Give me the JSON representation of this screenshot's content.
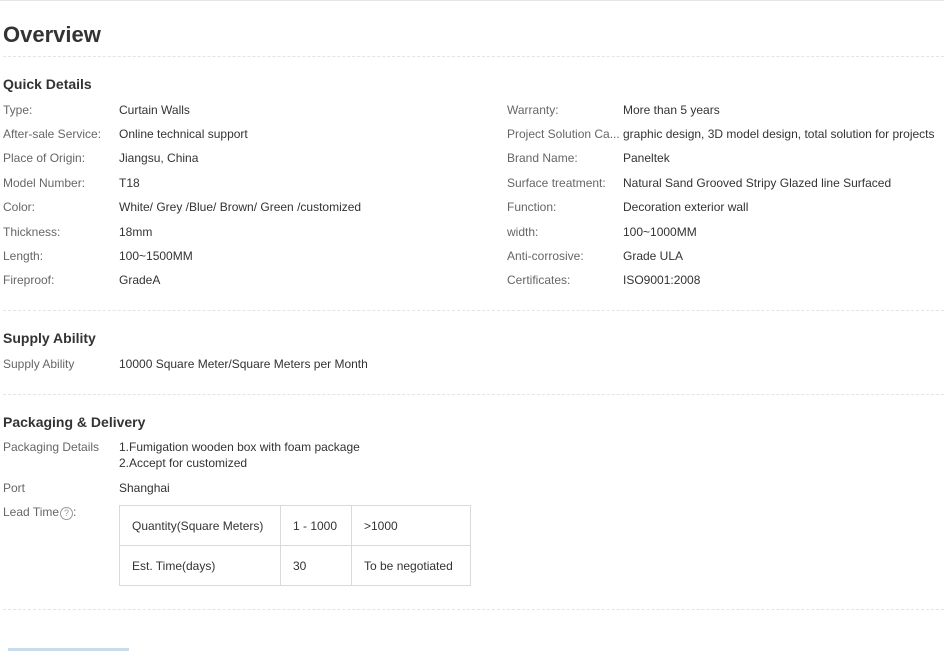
{
  "page": {
    "title": "Overview"
  },
  "quick_details": {
    "title": "Quick Details",
    "left": [
      {
        "label": "Type:",
        "value": "Curtain Walls"
      },
      {
        "label": "After-sale Service:",
        "value": "Online technical support"
      },
      {
        "label": "Place of Origin:",
        "value": "Jiangsu, China"
      },
      {
        "label": "Model Number:",
        "value": "T18"
      },
      {
        "label": "Color:",
        "value": "White/ Grey /Blue/ Brown/ Green /customized"
      },
      {
        "label": "Thickness:",
        "value": "18mm"
      },
      {
        "label": "Length:",
        "value": "100~1500MM"
      },
      {
        "label": "Fireproof:",
        "value": "GradeA"
      }
    ],
    "right": [
      {
        "label": "Warranty:",
        "value": "More than 5 years"
      },
      {
        "label": "Project Solution Ca...",
        "value": "graphic design, 3D model design, total solution for projects"
      },
      {
        "label": "Brand Name:",
        "value": "Paneltek"
      },
      {
        "label": "Surface treatment:",
        "value": "Natural Sand Grooved Stripy Glazed line Surfaced"
      },
      {
        "label": "Function:",
        "value": "Decoration exterior wall"
      },
      {
        "label": "width:",
        "value": "100~1000MM"
      },
      {
        "label": "Anti-corrosive:",
        "value": "Grade ULA"
      },
      {
        "label": "Certificates:",
        "value": "ISO9001:2008"
      }
    ]
  },
  "supply_ability": {
    "title": "Supply Ability",
    "label": "Supply Ability",
    "value": "10000 Square Meter/Square Meters per Month"
  },
  "packaging": {
    "title": "Packaging & Delivery",
    "details_label": "Packaging Details",
    "details_lines": [
      "1.Fumigation wooden box with foam package",
      "2.Accept for customized"
    ],
    "port_label": "Port",
    "port_value": "Shanghai",
    "lead_time_label": "Lead Time",
    "lead_time_suffix": ":",
    "help_icon": "?",
    "lead_table": {
      "rows": [
        [
          "Quantity(Square Meters)",
          "1 - 1000",
          ">1000"
        ],
        [
          "Est. Time(days)",
          "30",
          "To be negotiated"
        ]
      ]
    }
  }
}
